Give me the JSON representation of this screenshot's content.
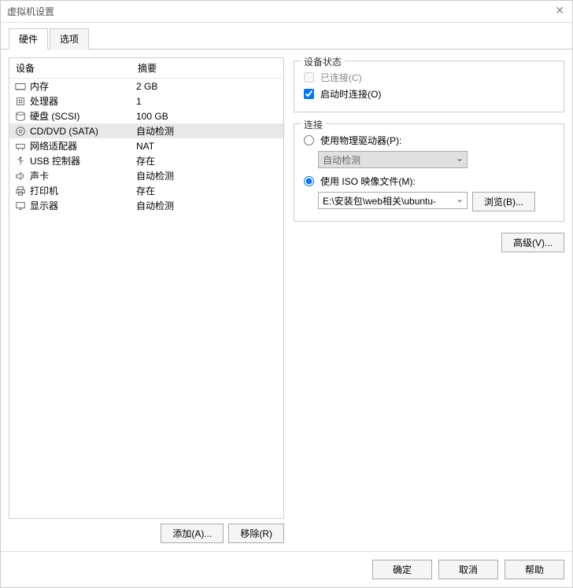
{
  "window": {
    "title": "虚拟机设置"
  },
  "tabs": {
    "hardware": "硬件",
    "options": "选项"
  },
  "headers": {
    "device": "设备",
    "summary": "摘要"
  },
  "devices": [
    {
      "icon": "memory",
      "name": "内存",
      "summary": "2 GB"
    },
    {
      "icon": "cpu",
      "name": "处理器",
      "summary": "1"
    },
    {
      "icon": "disk",
      "name": "硬盘 (SCSI)",
      "summary": "100 GB"
    },
    {
      "icon": "cd",
      "name": "CD/DVD (SATA)",
      "summary": "自动检测",
      "selected": true
    },
    {
      "icon": "nic",
      "name": "网络适配器",
      "summary": "NAT"
    },
    {
      "icon": "usb",
      "name": "USB 控制器",
      "summary": "存在"
    },
    {
      "icon": "sound",
      "name": "声卡",
      "summary": "自动检测"
    },
    {
      "icon": "printer",
      "name": "打印机",
      "summary": "存在"
    },
    {
      "icon": "display",
      "name": "显示器",
      "summary": "自动检测"
    }
  ],
  "list_buttons": {
    "add": "添加(A)...",
    "remove": "移除(R)"
  },
  "device_status": {
    "group_title": "设备状态",
    "connected": "已连接(C)",
    "connect_at_poweron": "启动时连接(O)"
  },
  "connection": {
    "group_title": "连接",
    "use_physical": "使用物理驱动器(P):",
    "physical_value": "自动检测",
    "use_iso": "使用 ISO 映像文件(M):",
    "iso_value": "E:\\安装包\\web相关\\ubuntu-",
    "browse": "浏览(B)..."
  },
  "advanced": "高级(V)...",
  "bottom": {
    "ok": "确定",
    "cancel": "取消",
    "help": "帮助"
  }
}
